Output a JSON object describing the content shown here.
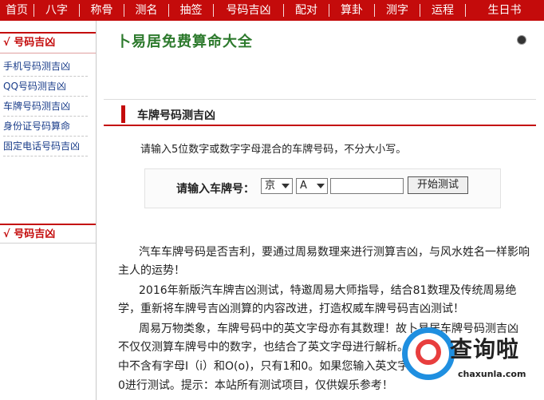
{
  "nav": [
    "首页",
    "八字",
    "称骨",
    "测名",
    "抽签",
    "号码吉凶",
    "配对",
    "算卦",
    "测字",
    "运程",
    "生日书"
  ],
  "sidebar": {
    "heading": "√ 号码吉凶",
    "items": [
      "手机号码测吉凶",
      "QQ号码测吉凶",
      "车牌号码测吉凶",
      "身份证号码算命",
      "固定电话号码吉凶"
    ],
    "heading2": "√ 号码吉凶"
  },
  "site_title": "卜易居免费算命大全",
  "section": {
    "title": "车牌号码测吉凶",
    "instruction": "请输入5位数字或数字字母混合的车牌号码，不分大小写。"
  },
  "form": {
    "label": "请输入车牌号：",
    "province_value": "京",
    "letter_value": "A",
    "plate_value": "",
    "submit_label": "开始测试"
  },
  "paragraphs": [
    "汽车车牌号码是否吉利，要通过周易数理来进行测算吉凶，与风水姓名一样影响",
    "主人的运势！",
    "2016年新版汽车牌吉凶测试，特邀周易大师指导，结合81数理及传统周易绝",
    "学，重新将车牌号吉凶测算的内容改进，打造权威车牌号码吉凶测试！",
    "周易万物类象，车牌号码中的英文字母亦有其数理！故卜易居车牌号码测吉凶",
    "不仅仅测算车牌号中的数字，也结合了英文字母进行解析。",
    "中不含有字母I（i）和O(o)，只有1和0。如果您输入英文字",
    "0进行测试。提示：本站所有测试项目，仅供娱乐参考！"
  ],
  "watermark": {
    "text": "查询啦",
    "sub": "chaxunla.com"
  },
  "colors": {
    "brand_red": "#c40b0b",
    "title_green": "#2d7a2d",
    "link_blue": "#1a3d8a"
  }
}
